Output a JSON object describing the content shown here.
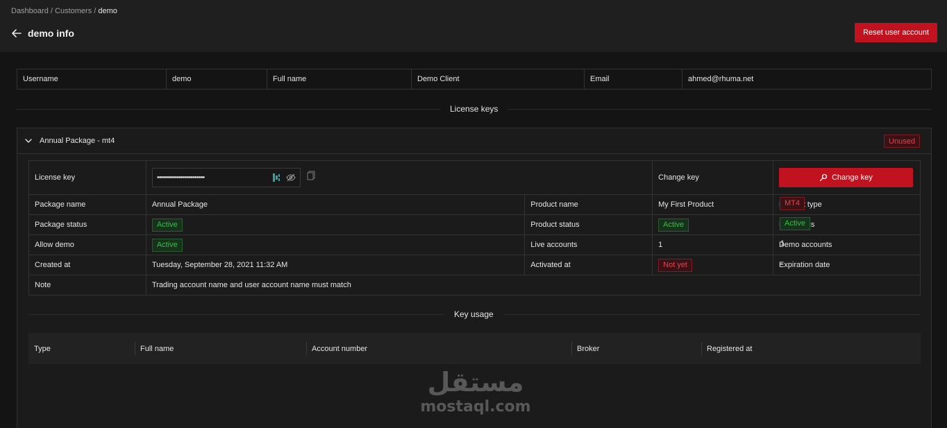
{
  "breadcrumb": {
    "items": [
      "Dashboard",
      "Customers"
    ],
    "current": "demo"
  },
  "header": {
    "title": "demo info",
    "reset_label": "Reset user account"
  },
  "user_info": [
    {
      "key": "username_label",
      "text": "Username"
    },
    {
      "key": "username_value",
      "text": "demo"
    },
    {
      "key": "fullname_label",
      "text": "Full name"
    },
    {
      "key": "fullname_value",
      "text": "Demo Client"
    },
    {
      "key": "email_label",
      "text": "Email"
    },
    {
      "key": "email_value",
      "text": "ahmed@rhuma.net"
    }
  ],
  "license_keys_heading": "License keys",
  "package": {
    "title": "Annual Package - mt4",
    "status_badge": "Unused",
    "license_key_label": "License key",
    "license_key_value": "••••••••••••••••••••••••",
    "change_key_label": "Change key",
    "change_key_button": "Change key",
    "rows": {
      "package_name_label": "Package name",
      "package_name": "Annual Package",
      "product_name_label": "Product name",
      "product_name": "My First Product",
      "product_type_label": "Product type",
      "product_type": "MT4",
      "package_status_label": "Package status",
      "package_status": "Active",
      "product_status_label": "Product status",
      "product_status": "Active",
      "key_status_label": "Key status",
      "key_status": "Active",
      "allow_demo_label": "Allow demo",
      "allow_demo": "Active",
      "live_accounts_label": "Live accounts",
      "live_accounts": "1",
      "demo_accounts_label": "Demo accounts",
      "demo_accounts": "1",
      "created_at_label": "Created at",
      "created_at": "Tuesday, September 28, 2021 11:32 AM",
      "activated_at_label": "Activated at",
      "activated_at": "Not yet",
      "expiration_label": "Expiration date",
      "expiration": "-",
      "note_label": "Note",
      "note": "Trading account name and user account name must match"
    }
  },
  "key_usage": {
    "heading": "Key usage",
    "columns": [
      "Type",
      "Full name",
      "Account number",
      "Broker",
      "Registered at"
    ]
  },
  "watermark": {
    "arabic": "مستقل",
    "latin": "mostaql.com"
  },
  "colors": {
    "accent": "#c1121f",
    "active": "#3fb950",
    "danger": "#e04550",
    "background": "#141414"
  },
  "icons": [
    "back-arrow-icon",
    "chevron-down-icon",
    "key-tool-icon",
    "eye-off-icon",
    "copy-icon",
    "search-key-icon"
  ]
}
